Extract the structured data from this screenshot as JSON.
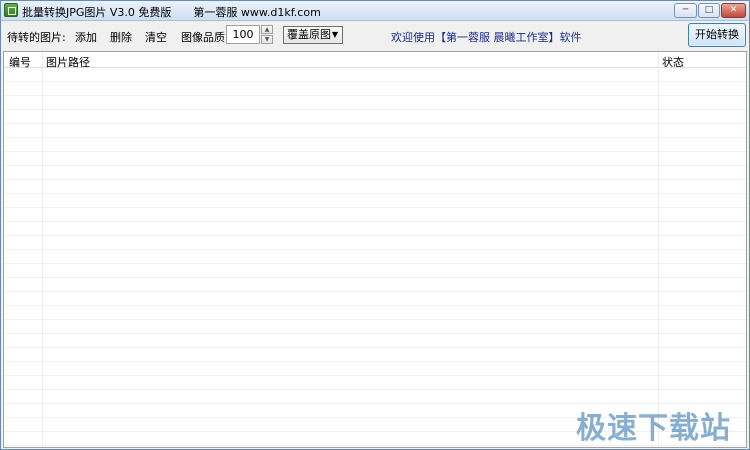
{
  "window": {
    "title": "批量转换JPG图片 V3.0 免费版　　第一蓉服 www.d1kf.com",
    "min_label": "─",
    "max_label": "□",
    "close_label": "✕"
  },
  "toolbar": {
    "pending_label": "待转的图片:",
    "add_label": "添加",
    "delete_label": "删除",
    "clear_label": "清空",
    "quality_label": "图像品质:",
    "quality_value": "100",
    "mode_value": "覆盖原图",
    "welcome_text": "欢迎使用【第一蓉服 晨曦工作室】软件",
    "start_label": "开始转换"
  },
  "list": {
    "columns": [
      "编号",
      "图片路径",
      "状态"
    ]
  },
  "watermark": "极速下载站",
  "colors": {
    "accent": "#1c2a8c",
    "titlebar": "#cfdff1"
  },
  "icons": {
    "app": "app-icon",
    "spin_up": "spinner-up-icon",
    "spin_down": "spinner-down-icon",
    "dropdown": "chevron-down-icon"
  }
}
